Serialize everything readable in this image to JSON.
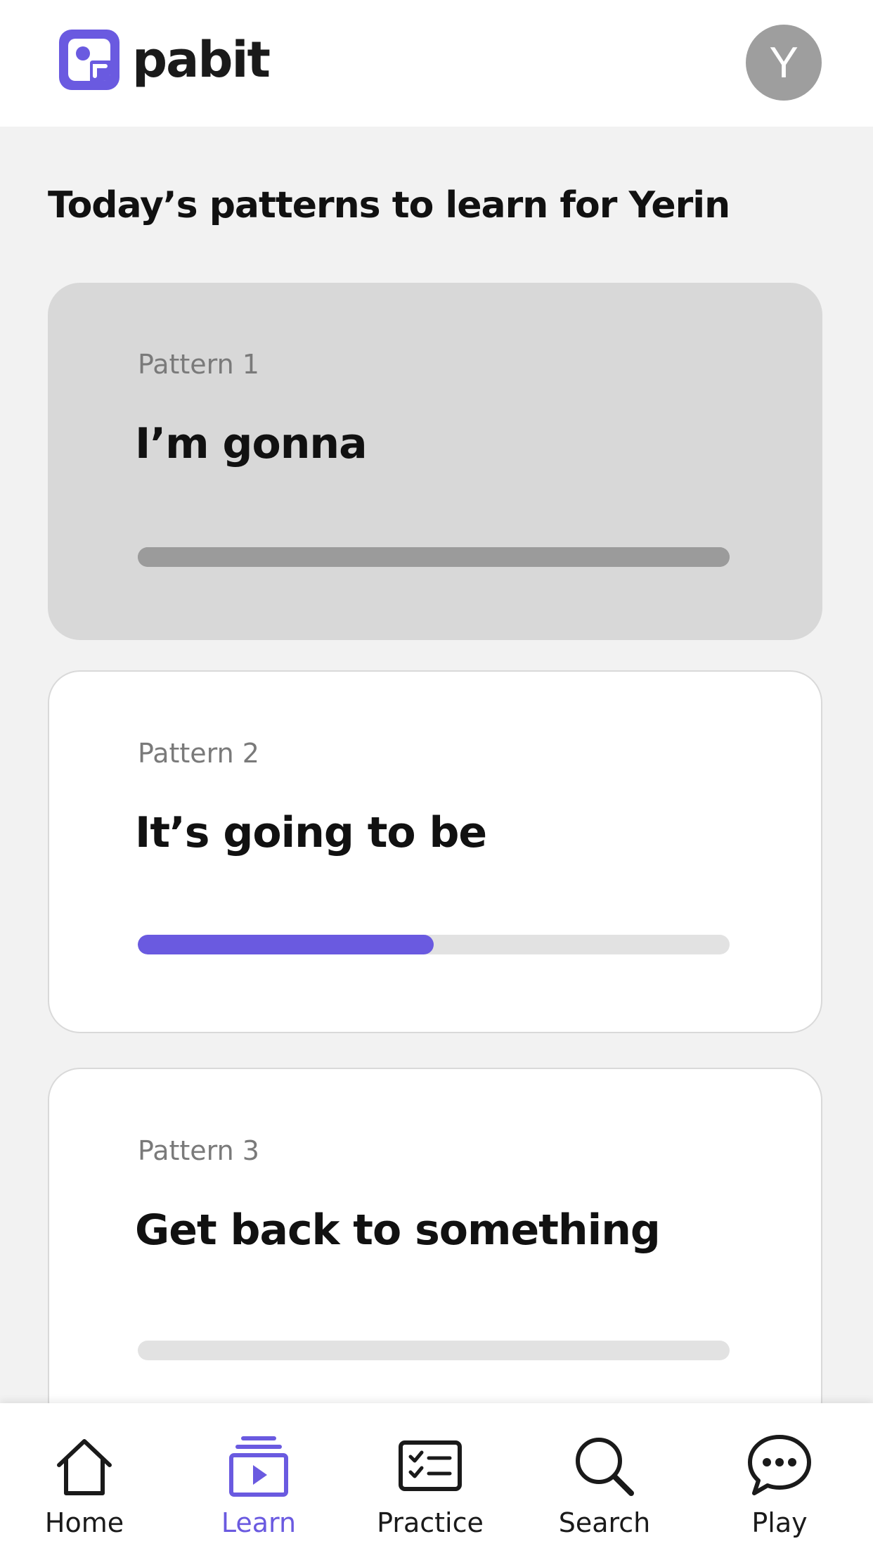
{
  "app": {
    "name": "pabit",
    "avatar_initial": "Y"
  },
  "colors": {
    "accent": "#6a5ae0",
    "inactive_card": "#d8d8d8",
    "track": "#e2e2e2"
  },
  "main": {
    "title": "Today’s patterns to learn for Yerin",
    "cards": [
      {
        "label": "Pattern 1",
        "title": "I’m gonna",
        "progress": 1.0,
        "state": "completed"
      },
      {
        "label": "Pattern 2",
        "title": "It’s going to be",
        "progress": 0.5,
        "state": "in-progress"
      },
      {
        "label": "Pattern 3",
        "title": "Get back to something",
        "progress": 0.0,
        "state": "not-started"
      }
    ]
  },
  "tabbar": {
    "selected": "Learn",
    "tabs": [
      {
        "label": "Home",
        "icon": "home-icon"
      },
      {
        "label": "Learn",
        "icon": "learn-video-icon"
      },
      {
        "label": "Practice",
        "icon": "checklist-icon"
      },
      {
        "label": "Search",
        "icon": "search-icon"
      },
      {
        "label": "Play",
        "icon": "chat-bubble-icon"
      }
    ]
  }
}
